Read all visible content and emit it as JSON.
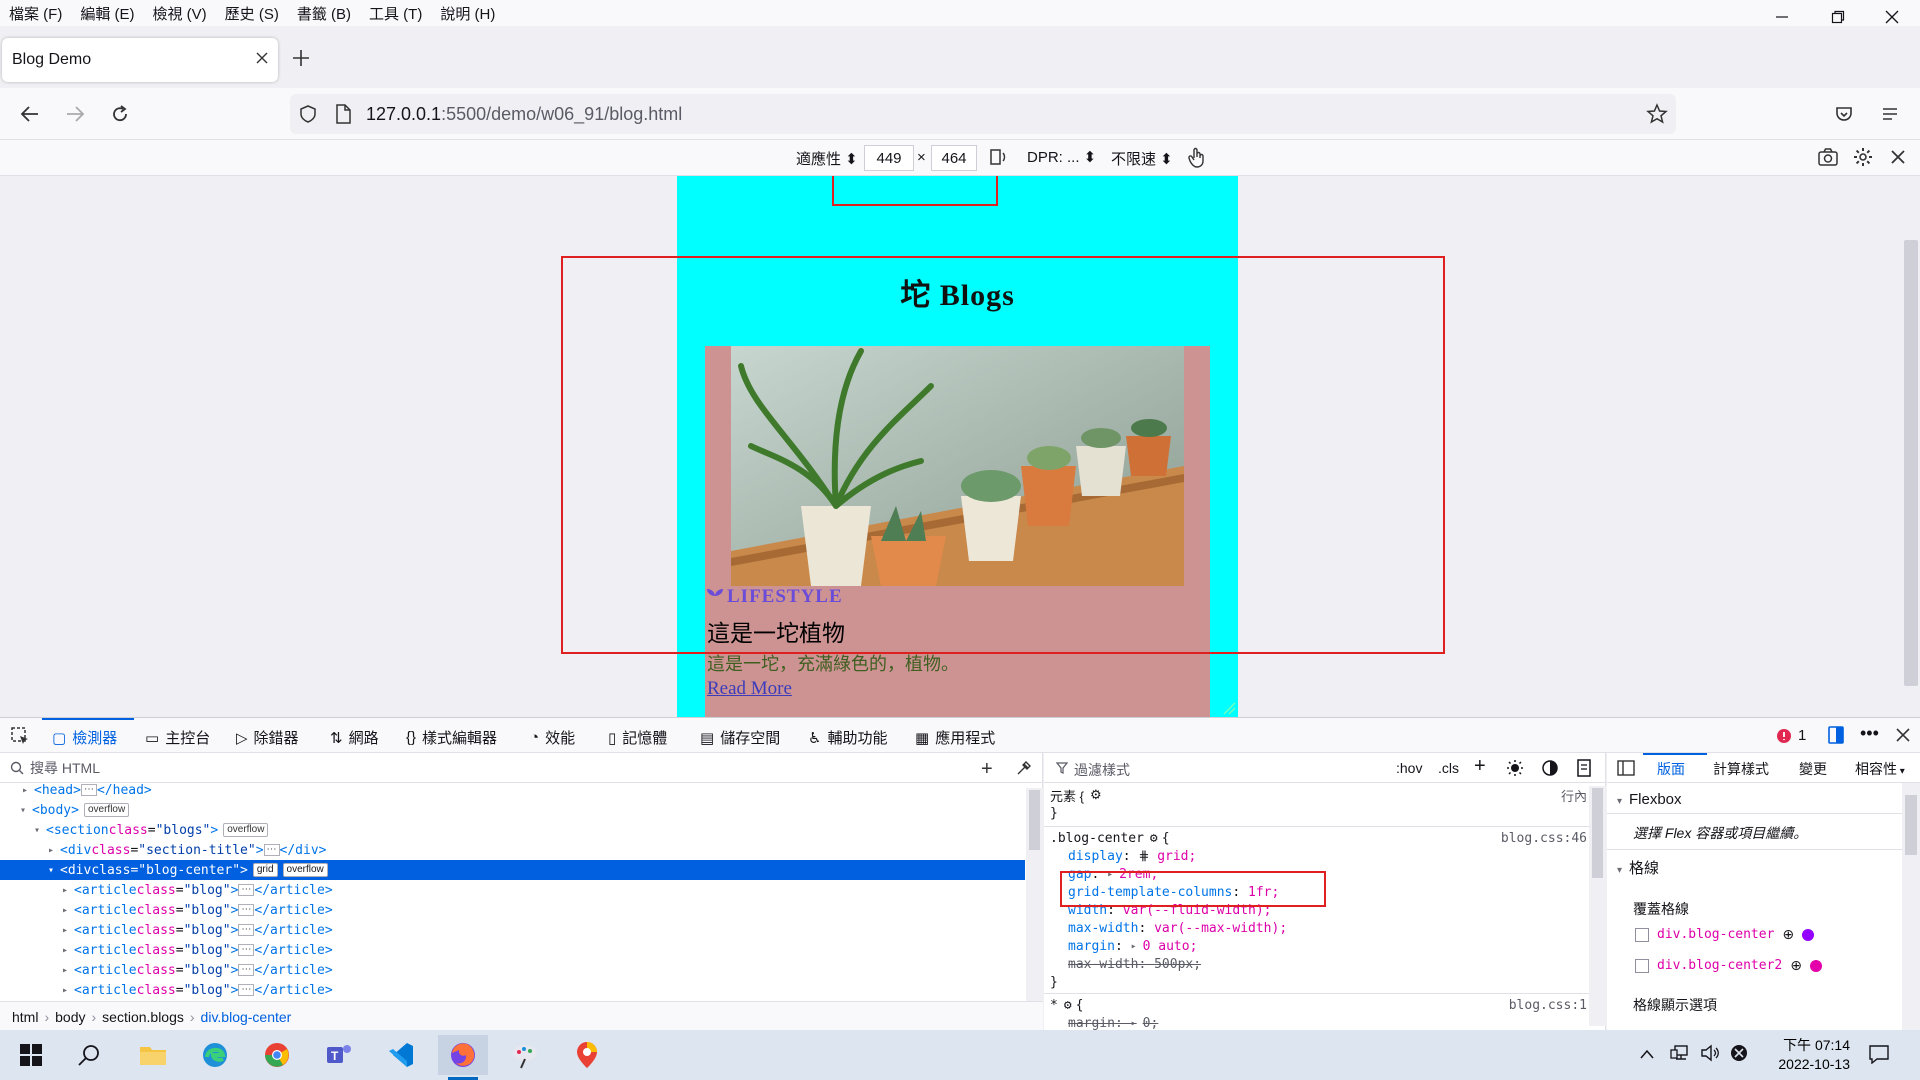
{
  "menubar": {
    "items": [
      "檔案 (F)",
      "編輯 (E)",
      "檢視 (V)",
      "歷史 (S)",
      "書籤 (B)",
      "工具 (T)",
      "說明 (H)"
    ]
  },
  "tab": {
    "title": "Blog Demo"
  },
  "navbar": {
    "url_host": "127.0.0.1",
    "url_path": ":5500/demo/w06_91/blog.html"
  },
  "rdm": {
    "device": "適應性",
    "width": "449",
    "times": "×",
    "height": "464",
    "dpr": "DPR: ...",
    "throttle": "不限速"
  },
  "page": {
    "title": "坨 Blogs",
    "category": "LIFESTYLE",
    "post_title": "這是一坨植物",
    "post_desc": "這是一坨，充滿綠色的，植物。",
    "read_more": "Read More",
    "background_color": "#00ffff",
    "card_color": "#cd9393"
  },
  "devtools": {
    "tabs": [
      "檢測器",
      "主控台",
      "除錯器",
      "網路",
      "樣式編輯器",
      "效能",
      "記憶體",
      "儲存空間",
      "輔助功能",
      "應用程式"
    ],
    "error_count": "1",
    "search_placeholder": "搜尋 HTML",
    "html_tree": {
      "head": "<head>",
      "head_close": "</head>",
      "body": "<body>",
      "body_badge": "overflow",
      "section": "<section",
      "section_attr": "class",
      "section_val": "\"blogs\"",
      "section_badge": "overflow",
      "title_div": "<div",
      "title_attr": "class",
      "title_val": "\"section-title\"",
      "title_close": "</div>",
      "center_div": "<div",
      "center_attr": "class",
      "center_val": "\"blog-center\"",
      "center_badge1": "grid",
      "center_badge2": "overflow",
      "article": "<article",
      "article_attr": "class",
      "article_val": "\"blog\"",
      "article_close": "</article>"
    },
    "breadcrumb": [
      "html",
      "body",
      "section.blogs",
      "div.blog-center"
    ],
    "rules": {
      "filter_placeholder": "過濾樣式",
      "hov": ":hov",
      "cls": ".cls",
      "element_selector": "元素 {",
      "element_close": "}",
      "inline_label": "行內",
      "selector": ".blog-center",
      "source": "blog.css:46",
      "props": [
        {
          "name": "display",
          "value": "grid;"
        },
        {
          "name": "gap",
          "value": "2rem;"
        },
        {
          "name": "grid-template-columns",
          "value": "1fr;"
        },
        {
          "name": "width",
          "value": "var(--fluid-width);"
        },
        {
          "name": "max-width",
          "value": "var(--max-width);"
        },
        {
          "name": "margin",
          "value": "0 auto;"
        },
        {
          "name": "max-width",
          "value": "500px;"
        }
      ],
      "rule_close": "}",
      "star_selector": "*",
      "star_source": "blog.css:1",
      "star_prop": "margin",
      "star_value": "0;"
    },
    "layout": {
      "tabs": [
        "版面",
        "計算樣式",
        "變更",
        "相容性"
      ],
      "flexbox_header": "Flexbox",
      "flexbox_hint": "選擇 Flex 容器或項目繼續。",
      "grid_header": "格線",
      "overlay_label": "覆蓋格線",
      "grids": [
        {
          "name": "div.blog-center",
          "color": "#9400ff"
        },
        {
          "name": "div.blog-center2",
          "color": "#e300aa"
        }
      ],
      "display_options": "格線顯示選項"
    }
  },
  "taskbar": {
    "time": "下午 07:14",
    "date": "2022-10-13"
  }
}
